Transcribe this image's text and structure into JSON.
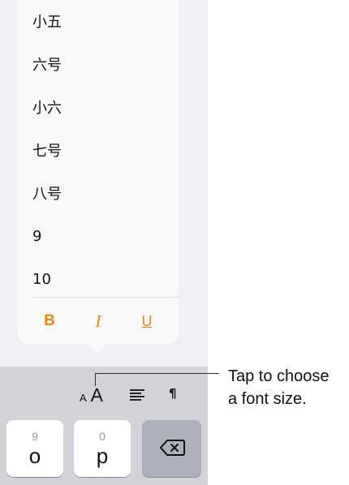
{
  "font_size_menu": {
    "items": [
      "小五",
      "六号",
      "小六",
      "七号",
      "八号",
      "9",
      "10"
    ],
    "style_buttons": {
      "bold": "B",
      "italic": "I",
      "underline": "U"
    },
    "accent_color": "#e8890c"
  },
  "format_toolbar": {
    "font_size_small": "A",
    "font_size_large": "A",
    "paragraph_glyph": "¶",
    "icons": [
      "font-size-icon",
      "align-left-icon",
      "paragraph-icon"
    ]
  },
  "keyboard": {
    "keys": [
      {
        "hint": "9",
        "letter": "o"
      },
      {
        "hint": "0",
        "letter": "p"
      }
    ],
    "delete_icon": "backspace-icon"
  },
  "callout": {
    "line1": "Tap to choose",
    "line2": "a font size."
  }
}
